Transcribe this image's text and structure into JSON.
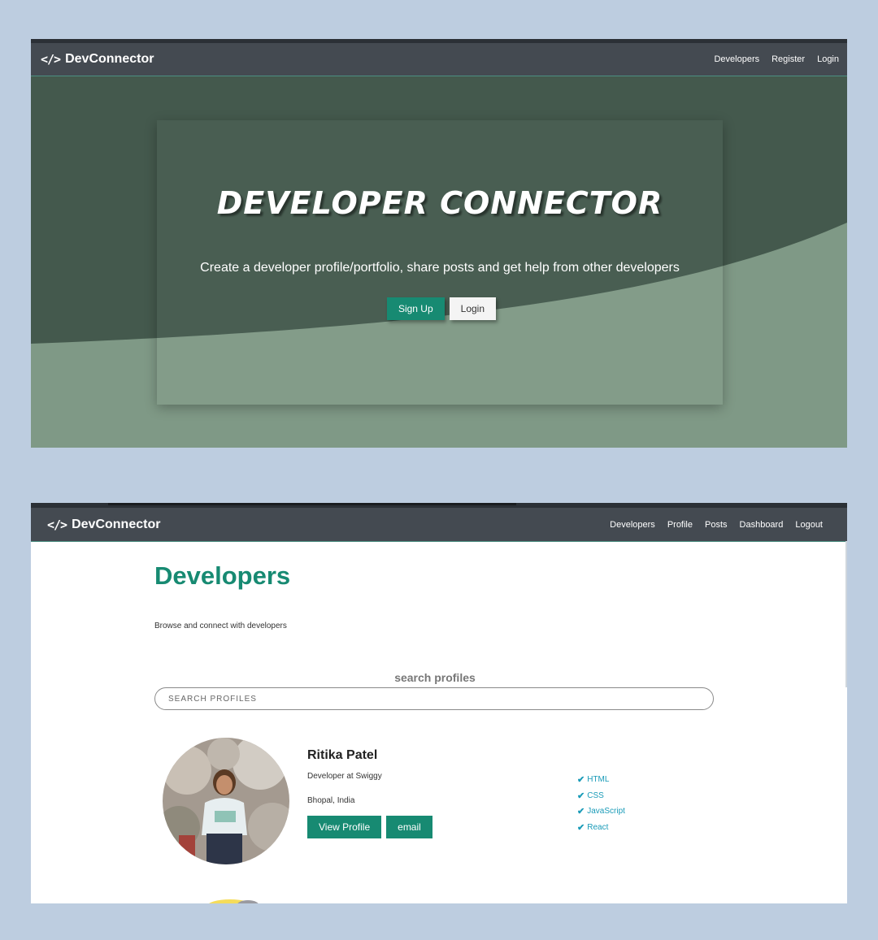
{
  "brand": {
    "name": "DevConnector",
    "icon": "code-icon"
  },
  "landing": {
    "nav": [
      "Developers",
      "Register",
      "Login"
    ],
    "title": "DEVELOPER CONNECTOR",
    "subtitle": "Create a developer profile/portfolio, share posts and get help from other developers",
    "signup_label": "Sign Up",
    "login_label": "Login"
  },
  "developers_page": {
    "nav": [
      "Developers",
      "Profile",
      "Posts",
      "Dashboard",
      "Logout"
    ],
    "title": "Developers",
    "lead": "Browse and connect with developers",
    "search_label": "search profiles",
    "search_placeholder": "SEARCH PROFILES",
    "profile": {
      "name": "Ritika Patel",
      "status": "Developer at Swiggy",
      "location": "Bhopal, India",
      "view_profile_label": "View Profile",
      "email_label": "email",
      "skills": [
        "HTML",
        "CSS",
        "JavaScript",
        "React"
      ]
    }
  },
  "colors": {
    "page_bg": "#bdcde0",
    "navbar": "#444a51",
    "primary": "#178a72",
    "skill_text": "#1a9bb8",
    "hero_dark": "#44594d",
    "hero_light": "#7f9986"
  }
}
